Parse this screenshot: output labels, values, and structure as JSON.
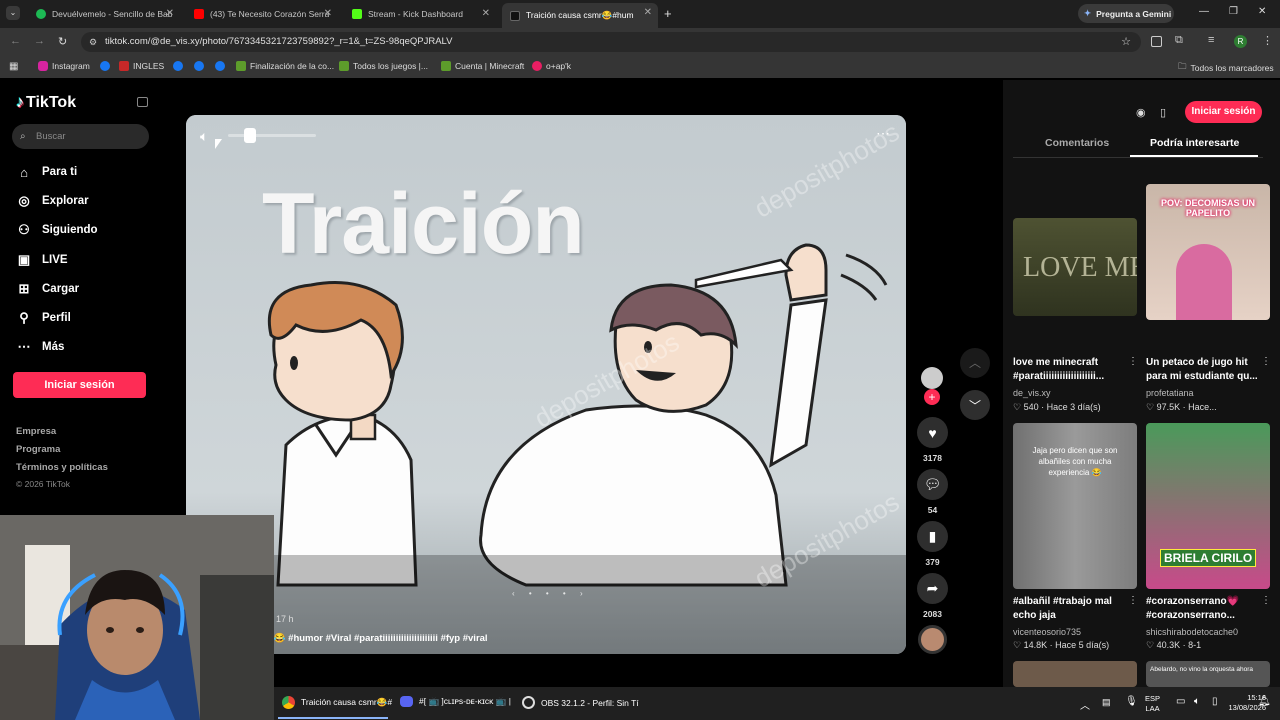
{
  "browser": {
    "tabs": [
      {
        "title": "Devuélvemelo - Sencillo de Bab",
        "color": "#1db954"
      },
      {
        "title": "(43) Te Necesito Corazón Serra",
        "color": "#ff0000"
      },
      {
        "title": "Stream - Kick Dashboard",
        "color": "#53fc18"
      },
      {
        "title": "Traición causa csmr😂#hum",
        "color": "#111111"
      }
    ],
    "gemini_label": "Pregunta a Gemini",
    "url": "tiktok.com/@de_vis.xy/photo/7673345321723759892?_r=1&_t=ZS-98qeQPJRALV",
    "bookmarks": [
      "Instagram",
      "INGLES",
      "Finalización de la co...",
      "Todos los juegos |...",
      "Cuenta | Minecraft",
      "o+ap'k"
    ],
    "all_bookmarks": "Todos los marcadores"
  },
  "tiktok": {
    "logo": "TikTok",
    "search_placeholder": "Buscar",
    "nav": [
      {
        "label": "Para ti",
        "icon": "home-icon"
      },
      {
        "label": "Explorar",
        "icon": "compass-icon"
      },
      {
        "label": "Siguiendo",
        "icon": "following-icon"
      },
      {
        "label": "LIVE",
        "icon": "live-icon"
      },
      {
        "label": "Cargar",
        "icon": "upload-icon"
      },
      {
        "label": "Perfil",
        "icon": "profile-icon"
      },
      {
        "label": "Más",
        "icon": "more-icon"
      }
    ],
    "login_label": "Iniciar sesión",
    "footer": [
      "Empresa",
      "Programa",
      "Términos y políticas",
      "© 2026 TikTok"
    ]
  },
  "post": {
    "title_text": "Traición",
    "watermark": "depositphotos",
    "date_fragment": "17 h",
    "caption": "r😂 #humor #Viral #paratiiiiiiiiiiiiiiiiiiiii #fyp #viral",
    "likes": "3178",
    "comments": "54",
    "saves": "379",
    "shares": "2083"
  },
  "right_panel": {
    "login_label": "Iniciar sesión",
    "tabs": [
      "Comentarios",
      "Podría interesarte"
    ],
    "cards": [
      {
        "title": "love me minecraft #paratiiiiiiiiiiiiiiiiiii...",
        "user": "de_vis.xy",
        "meta": "♡ 540 · Hace 3 día(s)",
        "thumb_text": "LOVE ME"
      },
      {
        "title": "Un petaco de jugo hit para mi estudiante qu...",
        "user": "profetatiana",
        "meta": "♡ 97.5K · Hace...",
        "thumb_text": "POV: DECOMISAS UN PAPELITO"
      },
      {
        "title": "#albañil #trabajo mal echo jaja",
        "user": "vicenteosorio735",
        "meta": "♡ 14.8K · Hace 5 día(s)",
        "thumb_text": "Jaja pero dicen que son albañiles con mucha experiencia 😂"
      },
      {
        "title": "#corazonserrano💗 #corazonserrano...",
        "user": "shicshirabodetocache0",
        "meta": "♡ 40.3K · 8-1",
        "thumb_text": "BRIELA CIRILO"
      },
      {
        "title": "",
        "user": "",
        "meta": "",
        "thumb_text": "Abelardo, no vino la orquesta ahora"
      }
    ]
  },
  "taskbar": {
    "items": [
      "Traición causa csmr😂#",
      "#[ 📺 ]ᴄʟɪᴘs-ᴅᴇ-ᴋɪᴄᴋ 📺 |",
      "OBS 32.1.2 - Perfil: Sin Tí"
    ],
    "lang": "ESP",
    "lang2": "LAA",
    "time": "15:16",
    "date": "13/08/2026"
  }
}
